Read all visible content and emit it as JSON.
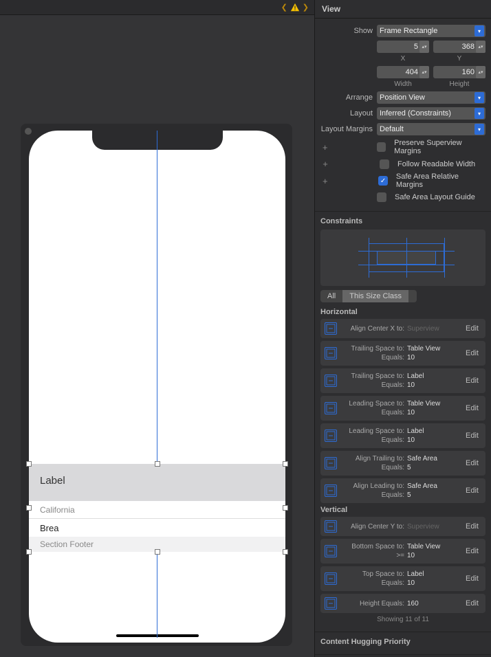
{
  "inspector_title": "View",
  "view": {
    "show_label": "Show",
    "show_value": "Frame Rectangle",
    "x": "5",
    "y": "368",
    "x_label": "X",
    "y_label": "Y",
    "width": "404",
    "height": "160",
    "w_label": "Width",
    "h_label": "Height",
    "arrange_label": "Arrange",
    "arrange_value": "Position View",
    "layout_label": "Layout",
    "layout_value": "Inferred (Constraints)",
    "margins_label": "Layout Margins",
    "margins_value": "Default",
    "opt1": "Preserve Superview Margins",
    "opt2": "Follow Readable Width",
    "opt3": "Safe Area Relative Margins",
    "opt4": "Safe Area Layout Guide"
  },
  "constraints": {
    "title": "Constraints",
    "seg_all": "All",
    "seg_this": "This Size Class",
    "horizontal": "Horizontal",
    "vertical": "Vertical",
    "items": [
      {
        "group": "h",
        "l1": "Align Center X to:",
        "v1": "Superview",
        "ph": true,
        "l2": "",
        "v2": ""
      },
      {
        "group": "h",
        "l1": "Trailing Space to:",
        "v1": "Table View",
        "l2": "Equals:",
        "v2": "10"
      },
      {
        "group": "h",
        "l1": "Trailing Space to:",
        "v1": "Label",
        "l2": "Equals:",
        "v2": "10"
      },
      {
        "group": "h",
        "l1": "Leading Space to:",
        "v1": "Table View",
        "l2": "Equals:",
        "v2": "10"
      },
      {
        "group": "h",
        "l1": "Leading Space to:",
        "v1": "Label",
        "l2": "Equals:",
        "v2": "10"
      },
      {
        "group": "h",
        "l1": "Align Trailing to:",
        "v1": "Safe Area",
        "l2": "Equals:",
        "v2": "5"
      },
      {
        "group": "h",
        "l1": "Align Leading to:",
        "v1": "Safe Area",
        "l2": "Equals:",
        "v2": "5"
      },
      {
        "group": "v",
        "l1": "Align Center Y to:",
        "v1": "Superview",
        "ph": true,
        "l2": "",
        "v2": ""
      },
      {
        "group": "v",
        "l1": "Bottom Space to:",
        "v1": "Table View",
        "l2": ">=",
        "v2": "10"
      },
      {
        "group": "v",
        "l1": "Top Space to:",
        "v1": "Label",
        "l2": "Equals:",
        "v2": "10"
      },
      {
        "group": "v",
        "l1": "Height Equals:",
        "v1": "160",
        "l2": "",
        "v2": ""
      }
    ],
    "edit": "Edit",
    "showing": "Showing 11 of 11"
  },
  "chp": {
    "title": "Content Hugging Priority"
  },
  "canvas": {
    "header": "Label",
    "california": "California",
    "brea": "Brea",
    "footer": "Section Footer"
  }
}
